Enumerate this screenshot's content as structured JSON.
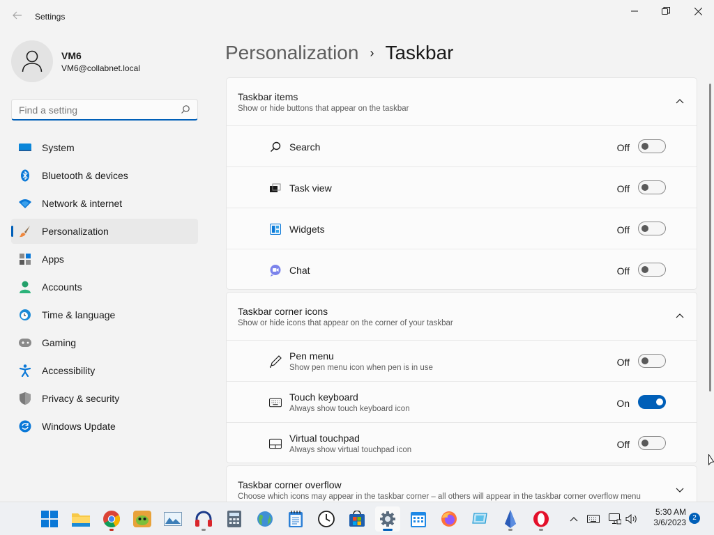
{
  "window": {
    "title": "Settings"
  },
  "user": {
    "name": "VM6",
    "email": "VM6@collabnet.local"
  },
  "search": {
    "placeholder": "Find a setting"
  },
  "sidebar": {
    "items": [
      {
        "label": "System",
        "icon": "monitor-icon"
      },
      {
        "label": "Bluetooth & devices",
        "icon": "bluetooth-icon"
      },
      {
        "label": "Network & internet",
        "icon": "wifi-icon"
      },
      {
        "label": "Personalization",
        "icon": "brush-icon",
        "selected": true
      },
      {
        "label": "Apps",
        "icon": "apps-icon"
      },
      {
        "label": "Accounts",
        "icon": "account-icon"
      },
      {
        "label": "Time & language",
        "icon": "clock-globe-icon"
      },
      {
        "label": "Gaming",
        "icon": "gamepad-icon"
      },
      {
        "label": "Accessibility",
        "icon": "accessibility-icon"
      },
      {
        "label": "Privacy & security",
        "icon": "shield-icon"
      },
      {
        "label": "Windows Update",
        "icon": "update-icon"
      }
    ]
  },
  "breadcrumb": {
    "parent": "Personalization",
    "separator": "›",
    "current": "Taskbar"
  },
  "sections": [
    {
      "title": "Taskbar items",
      "subtitle": "Show or hide buttons that appear on the taskbar",
      "expanded": true,
      "rows": [
        {
          "label": "Search",
          "state": "Off",
          "on": false,
          "icon": "search-icon"
        },
        {
          "label": "Task view",
          "state": "Off",
          "on": false,
          "icon": "task-view-icon"
        },
        {
          "label": "Widgets",
          "state": "Off",
          "on": false,
          "icon": "widgets-icon"
        },
        {
          "label": "Chat",
          "state": "Off",
          "on": false,
          "icon": "chat-icon"
        }
      ]
    },
    {
      "title": "Taskbar corner icons",
      "subtitle": "Show or hide icons that appear on the corner of your taskbar",
      "expanded": true,
      "rows": [
        {
          "label": "Pen menu",
          "sub": "Show pen menu icon when pen is in use",
          "state": "Off",
          "on": false,
          "icon": "pen-icon"
        },
        {
          "label": "Touch keyboard",
          "sub": "Always show touch keyboard icon",
          "state": "On",
          "on": true,
          "icon": "keyboard-icon"
        },
        {
          "label": "Virtual touchpad",
          "sub": "Always show virtual touchpad icon",
          "state": "Off",
          "on": false,
          "icon": "touchpad-icon"
        }
      ]
    },
    {
      "title": "Taskbar corner overflow",
      "subtitle": "Choose which icons may appear in the taskbar corner – all others will appear in the taskbar corner overflow menu",
      "expanded": false
    }
  ],
  "taskbar": {
    "apps": [
      "start-icon",
      "file-explorer-icon",
      "chrome-icon",
      "game-app-icon",
      "photos-icon",
      "headphones-app-icon",
      "calculator-icon",
      "globe-app-icon",
      "notepad-icon",
      "clock-app-icon",
      "store-icon",
      "settings-icon",
      "calendar-icon",
      "firefox-icon",
      "remote-app-icon",
      "sketch-app-icon",
      "opera-icon"
    ],
    "clock": {
      "time": "5:30 AM",
      "date": "3/6/2023"
    },
    "notifications": "2"
  },
  "colors": {
    "accent": "#005fb8",
    "background": "#f3f3f3",
    "card": "#fbfbfb"
  }
}
